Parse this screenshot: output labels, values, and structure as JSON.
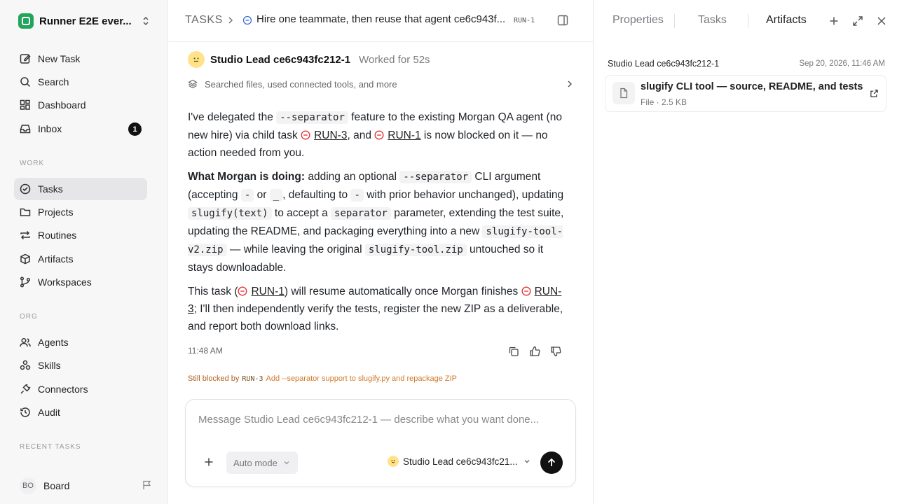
{
  "workspace": {
    "name": "Runner E2E ever..."
  },
  "nav": {
    "new_task": "New Task",
    "search": "Search",
    "dashboard": "Dashboard",
    "inbox": "Inbox",
    "inbox_count": "1",
    "work_label": "WORK",
    "tasks": "Tasks",
    "projects": "Projects",
    "routines": "Routines",
    "artifacts": "Artifacts",
    "workspaces": "Workspaces",
    "org_label": "ORG",
    "agents": "Agents",
    "skills": "Skills",
    "connectors": "Connectors",
    "audit": "Audit",
    "recent_label": "RECENT TASKS"
  },
  "user": {
    "initials": "BO",
    "name": "Board"
  },
  "header": {
    "section": "TASKS",
    "title": "Hire one teammate, then reuse that agent ce6c943f...",
    "run_id": "RUN-1"
  },
  "message": {
    "agent_name": "Studio Lead ce6c943fc212-1",
    "worked_for": "Worked for 52s",
    "activity": "Searched files, used connected tools, and more",
    "p1": {
      "a": "I've delegated the ",
      "code": "--separator",
      "b": " feature to the existing Morgan QA agent (no new hire) via child task ",
      "run3": "RUN-3",
      "c": ", and ",
      "run1": "RUN-1",
      "d": " is now blocked on it — no action needed from you."
    },
    "p2": {
      "bold": "What Morgan is doing:",
      "a": " adding an optional ",
      "code1": "--separator",
      "b": " CLI argument (accepting ",
      "code2": "-",
      "c": " or ",
      "code3": "_",
      "d": ", defaulting to ",
      "code4": "-",
      "e": " with prior behavior unchanged), updating ",
      "code5": "slugify(text)",
      "f": " to accept a ",
      "code6": "separator",
      "g": " parameter, extending the test suite, updating the README, and packaging everything into a new ",
      "code7": "slugify-tool-v2.zip",
      "h": " — while leaving the original ",
      "code8": "slugify-tool.zip",
      "i": " untouched so it stays downloadable."
    },
    "p3": {
      "a": "This task (",
      "run1": "RUN-1",
      "b": ") will resume automatically once Morgan finishes ",
      "run3": "RUN-3",
      "c": "; I'll then independently verify the tests, register the new ZIP as a deliverable, and report both download links."
    },
    "time": "11:48 AM"
  },
  "blocked": {
    "label": "Still blocked by",
    "run_id": "RUN-3",
    "title": "Add --separator support to slugify.py and repackage ZIP"
  },
  "composer": {
    "placeholder": "Message Studio Lead ce6c943fc212-1 — describe what you want done...",
    "mode": "Auto mode",
    "agent": "Studio Lead ce6c943fc21..."
  },
  "panel": {
    "tabs": [
      "Properties",
      "Tasks",
      "Artifacts"
    ],
    "active_tab": "Artifacts",
    "artifact_owner": "Studio Lead ce6c943fc212-1",
    "artifact_date": "Sep 20, 2026, 11:46 AM",
    "artifact_title": "slugify CLI tool — source, README, and tests",
    "artifact_meta": "File · 2.5 KB"
  },
  "colors": {
    "accent_green": "#22a55b",
    "blocked_red": "#e03b3b",
    "warning_orange": "#b25f1a",
    "status_blue": "#3b6fd6"
  }
}
